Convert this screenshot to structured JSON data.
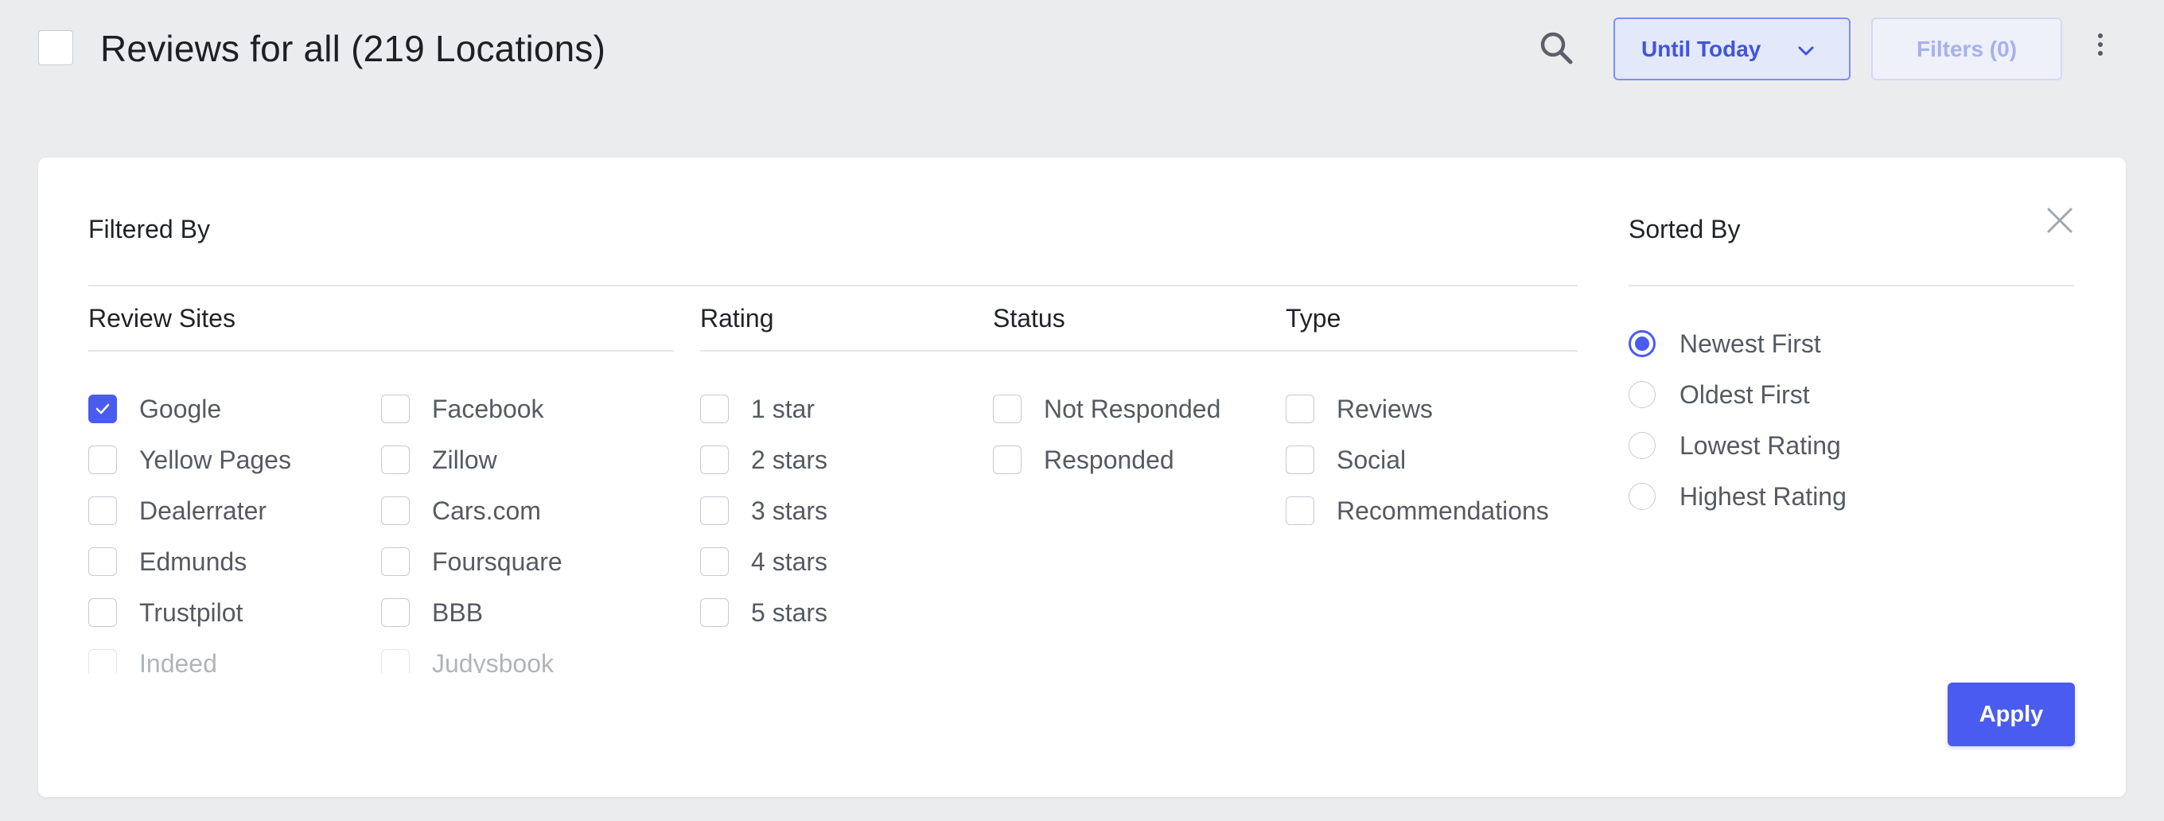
{
  "header": {
    "title": "Reviews for all (219 Locations)",
    "date_filter_label": "Until Today",
    "filters_label": "Filters (0)"
  },
  "panel": {
    "filtered_by": "Filtered By",
    "sorted_by": "Sorted By",
    "apply_label": "Apply",
    "review_sites": {
      "heading": "Review Sites",
      "col1": [
        {
          "label": "Google",
          "checked": true
        },
        {
          "label": "Yellow Pages",
          "checked": false
        },
        {
          "label": "Dealerrater",
          "checked": false
        },
        {
          "label": "Edmunds",
          "checked": false
        },
        {
          "label": "Trustpilot",
          "checked": false
        },
        {
          "label": "Indeed",
          "checked": false
        }
      ],
      "col2": [
        {
          "label": "Facebook",
          "checked": false
        },
        {
          "label": "Zillow",
          "checked": false
        },
        {
          "label": "Cars.com",
          "checked": false
        },
        {
          "label": "Foursquare",
          "checked": false
        },
        {
          "label": "BBB",
          "checked": false
        },
        {
          "label": "Judysbook",
          "checked": false
        }
      ]
    },
    "rating": {
      "heading": "Rating",
      "options": [
        {
          "label": "1 star",
          "checked": false
        },
        {
          "label": "2 stars",
          "checked": false
        },
        {
          "label": "3 stars",
          "checked": false
        },
        {
          "label": "4 stars",
          "checked": false
        },
        {
          "label": "5 stars",
          "checked": false
        }
      ]
    },
    "status": {
      "heading": "Status",
      "options": [
        {
          "label": "Not Responded",
          "checked": false
        },
        {
          "label": "Responded",
          "checked": false
        }
      ]
    },
    "type": {
      "heading": "Type",
      "options": [
        {
          "label": "Reviews",
          "checked": false
        },
        {
          "label": "Social",
          "checked": false
        },
        {
          "label": "Recommendations",
          "checked": false
        }
      ]
    },
    "sort_options": [
      {
        "label": "Newest First",
        "selected": true
      },
      {
        "label": "Oldest First",
        "selected": false
      },
      {
        "label": "Lowest Rating",
        "selected": false
      },
      {
        "label": "Highest Rating",
        "selected": false
      }
    ]
  },
  "colors": {
    "accent": "#4a5cef",
    "background": "#ebecee"
  },
  "icons": {
    "search": "search-icon",
    "dropdown": "chevron-down-icon",
    "more": "more-vertical-icon",
    "close": "close-icon",
    "check": "check-icon"
  }
}
